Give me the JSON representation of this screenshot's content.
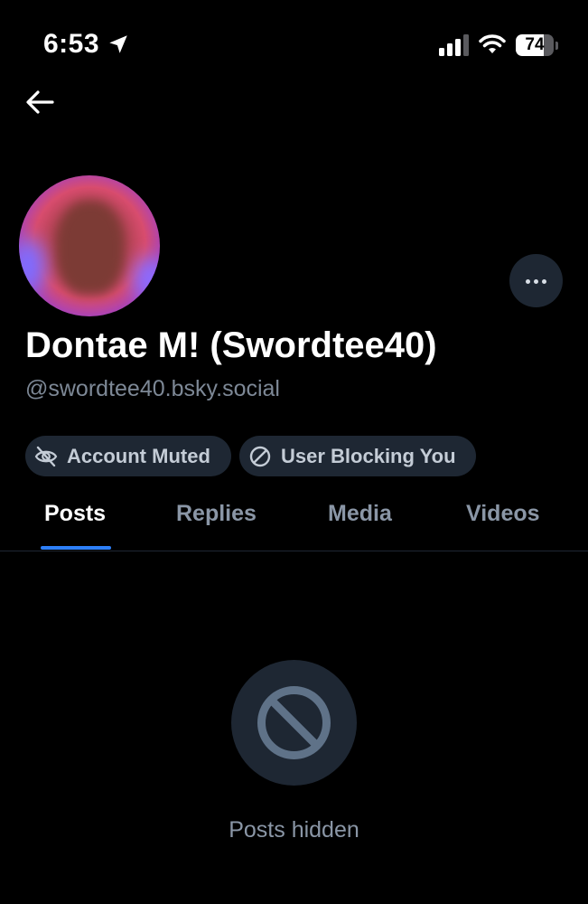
{
  "status_bar": {
    "time": "6:53",
    "battery": "74",
    "battery_level": 0.74,
    "icons": [
      "location-arrow-icon",
      "signal-icon",
      "wifi-icon",
      "battery-icon"
    ]
  },
  "header": {
    "back_icon": "back-arrow-icon",
    "more_icon": "ellipsis-icon"
  },
  "profile": {
    "display_name": "Dontae M! (Swordtee40)",
    "handle": "@swordtee40.bsky.social",
    "badges": [
      {
        "label": "Account Muted",
        "icon": "eye-slash-icon"
      },
      {
        "label": "User Blocking You",
        "icon": "block-icon"
      }
    ]
  },
  "tabs": [
    {
      "label": "Posts",
      "active": true
    },
    {
      "label": "Replies",
      "active": false
    },
    {
      "label": "Media",
      "active": false
    },
    {
      "label": "Videos",
      "active": false
    }
  ],
  "empty_state": {
    "icon": "block-icon",
    "label": "Posts hidden"
  },
  "colors": {
    "background": "#000000",
    "surface": "#1e2733",
    "accent": "#2d7ff9",
    "muted_text": "#7d8896"
  }
}
